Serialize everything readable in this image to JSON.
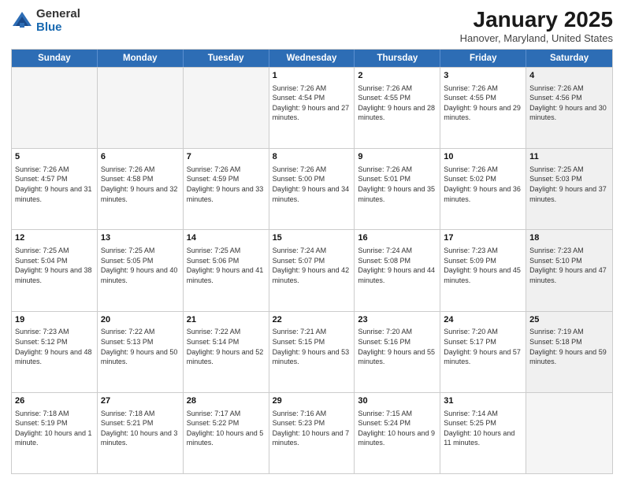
{
  "logo": {
    "general": "General",
    "blue": "Blue"
  },
  "title": "January 2025",
  "subtitle": "Hanover, Maryland, United States",
  "headers": [
    "Sunday",
    "Monday",
    "Tuesday",
    "Wednesday",
    "Thursday",
    "Friday",
    "Saturday"
  ],
  "weeks": [
    [
      {
        "day": "",
        "info": "",
        "empty": true
      },
      {
        "day": "",
        "info": "",
        "empty": true
      },
      {
        "day": "",
        "info": "",
        "empty": true
      },
      {
        "day": "1",
        "info": "Sunrise: 7:26 AM\nSunset: 4:54 PM\nDaylight: 9 hours and 27 minutes.",
        "empty": false
      },
      {
        "day": "2",
        "info": "Sunrise: 7:26 AM\nSunset: 4:55 PM\nDaylight: 9 hours and 28 minutes.",
        "empty": false
      },
      {
        "day": "3",
        "info": "Sunrise: 7:26 AM\nSunset: 4:55 PM\nDaylight: 9 hours and 29 minutes.",
        "empty": false
      },
      {
        "day": "4",
        "info": "Sunrise: 7:26 AM\nSunset: 4:56 PM\nDaylight: 9 hours and 30 minutes.",
        "empty": false,
        "shaded": true
      }
    ],
    [
      {
        "day": "5",
        "info": "Sunrise: 7:26 AM\nSunset: 4:57 PM\nDaylight: 9 hours and 31 minutes.",
        "empty": false
      },
      {
        "day": "6",
        "info": "Sunrise: 7:26 AM\nSunset: 4:58 PM\nDaylight: 9 hours and 32 minutes.",
        "empty": false
      },
      {
        "day": "7",
        "info": "Sunrise: 7:26 AM\nSunset: 4:59 PM\nDaylight: 9 hours and 33 minutes.",
        "empty": false
      },
      {
        "day": "8",
        "info": "Sunrise: 7:26 AM\nSunset: 5:00 PM\nDaylight: 9 hours and 34 minutes.",
        "empty": false
      },
      {
        "day": "9",
        "info": "Sunrise: 7:26 AM\nSunset: 5:01 PM\nDaylight: 9 hours and 35 minutes.",
        "empty": false
      },
      {
        "day": "10",
        "info": "Sunrise: 7:26 AM\nSunset: 5:02 PM\nDaylight: 9 hours and 36 minutes.",
        "empty": false
      },
      {
        "day": "11",
        "info": "Sunrise: 7:25 AM\nSunset: 5:03 PM\nDaylight: 9 hours and 37 minutes.",
        "empty": false,
        "shaded": true
      }
    ],
    [
      {
        "day": "12",
        "info": "Sunrise: 7:25 AM\nSunset: 5:04 PM\nDaylight: 9 hours and 38 minutes.",
        "empty": false
      },
      {
        "day": "13",
        "info": "Sunrise: 7:25 AM\nSunset: 5:05 PM\nDaylight: 9 hours and 40 minutes.",
        "empty": false
      },
      {
        "day": "14",
        "info": "Sunrise: 7:25 AM\nSunset: 5:06 PM\nDaylight: 9 hours and 41 minutes.",
        "empty": false
      },
      {
        "day": "15",
        "info": "Sunrise: 7:24 AM\nSunset: 5:07 PM\nDaylight: 9 hours and 42 minutes.",
        "empty": false
      },
      {
        "day": "16",
        "info": "Sunrise: 7:24 AM\nSunset: 5:08 PM\nDaylight: 9 hours and 44 minutes.",
        "empty": false
      },
      {
        "day": "17",
        "info": "Sunrise: 7:23 AM\nSunset: 5:09 PM\nDaylight: 9 hours and 45 minutes.",
        "empty": false
      },
      {
        "day": "18",
        "info": "Sunrise: 7:23 AM\nSunset: 5:10 PM\nDaylight: 9 hours and 47 minutes.",
        "empty": false,
        "shaded": true
      }
    ],
    [
      {
        "day": "19",
        "info": "Sunrise: 7:23 AM\nSunset: 5:12 PM\nDaylight: 9 hours and 48 minutes.",
        "empty": false
      },
      {
        "day": "20",
        "info": "Sunrise: 7:22 AM\nSunset: 5:13 PM\nDaylight: 9 hours and 50 minutes.",
        "empty": false
      },
      {
        "day": "21",
        "info": "Sunrise: 7:22 AM\nSunset: 5:14 PM\nDaylight: 9 hours and 52 minutes.",
        "empty": false
      },
      {
        "day": "22",
        "info": "Sunrise: 7:21 AM\nSunset: 5:15 PM\nDaylight: 9 hours and 53 minutes.",
        "empty": false
      },
      {
        "day": "23",
        "info": "Sunrise: 7:20 AM\nSunset: 5:16 PM\nDaylight: 9 hours and 55 minutes.",
        "empty": false
      },
      {
        "day": "24",
        "info": "Sunrise: 7:20 AM\nSunset: 5:17 PM\nDaylight: 9 hours and 57 minutes.",
        "empty": false
      },
      {
        "day": "25",
        "info": "Sunrise: 7:19 AM\nSunset: 5:18 PM\nDaylight: 9 hours and 59 minutes.",
        "empty": false,
        "shaded": true
      }
    ],
    [
      {
        "day": "26",
        "info": "Sunrise: 7:18 AM\nSunset: 5:19 PM\nDaylight: 10 hours and 1 minute.",
        "empty": false
      },
      {
        "day": "27",
        "info": "Sunrise: 7:18 AM\nSunset: 5:21 PM\nDaylight: 10 hours and 3 minutes.",
        "empty": false
      },
      {
        "day": "28",
        "info": "Sunrise: 7:17 AM\nSunset: 5:22 PM\nDaylight: 10 hours and 5 minutes.",
        "empty": false
      },
      {
        "day": "29",
        "info": "Sunrise: 7:16 AM\nSunset: 5:23 PM\nDaylight: 10 hours and 7 minutes.",
        "empty": false
      },
      {
        "day": "30",
        "info": "Sunrise: 7:15 AM\nSunset: 5:24 PM\nDaylight: 10 hours and 9 minutes.",
        "empty": false
      },
      {
        "day": "31",
        "info": "Sunrise: 7:14 AM\nSunset: 5:25 PM\nDaylight: 10 hours and 11 minutes.",
        "empty": false
      },
      {
        "day": "",
        "info": "",
        "empty": true,
        "shaded": true
      }
    ]
  ]
}
